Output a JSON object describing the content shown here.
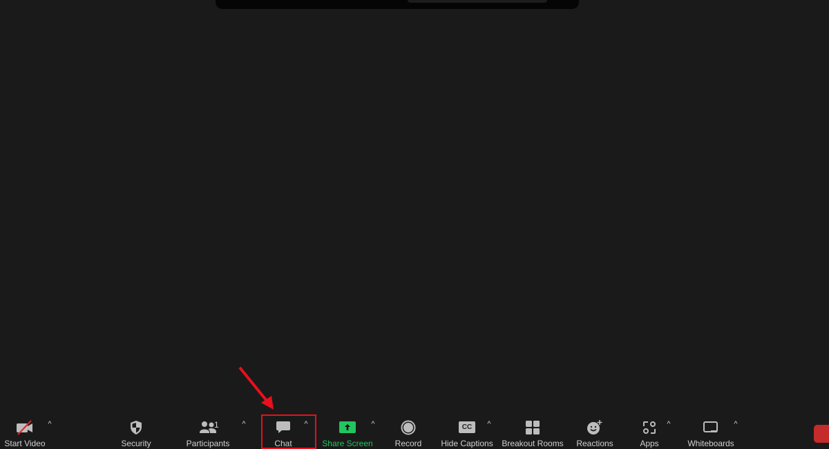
{
  "toolbar": {
    "items": [
      {
        "label": "Start Video",
        "icon": "video-off-icon"
      },
      {
        "label": "Security",
        "icon": "shield-icon"
      },
      {
        "label": "Participants",
        "icon": "participants-icon",
        "count": "1"
      },
      {
        "label": "Chat",
        "icon": "chat-icon"
      },
      {
        "label": "Share Screen",
        "icon": "share-screen-icon"
      },
      {
        "label": "Record",
        "icon": "record-icon"
      },
      {
        "label": "Hide Captions",
        "icon": "cc-icon",
        "icon_text": "CC"
      },
      {
        "label": "Breakout Rooms",
        "icon": "breakout-rooms-icon"
      },
      {
        "label": "Reactions",
        "icon": "reactions-icon"
      },
      {
        "label": "Apps",
        "icon": "apps-icon"
      },
      {
        "label": "Whiteboards",
        "icon": "whiteboard-icon"
      }
    ],
    "caret": "^"
  },
  "colors": {
    "background": "#1a1a1a",
    "share_green": "#22c55e",
    "highlight_red": "#e8101c",
    "end_red": "#c42b2b"
  }
}
